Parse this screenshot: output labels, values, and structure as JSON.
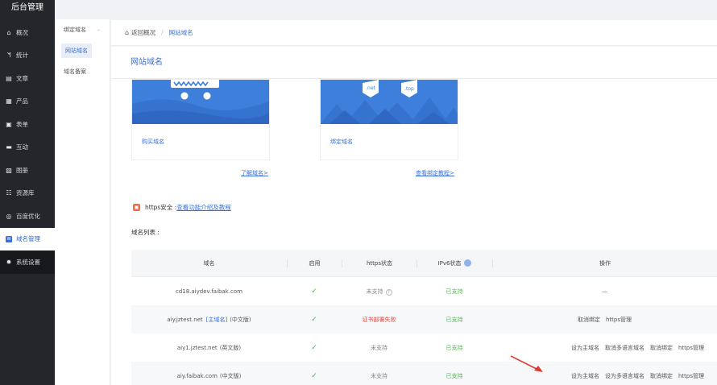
{
  "app": {
    "title": "后台管理"
  },
  "nav": {
    "items": [
      {
        "label": "概况",
        "icon": "home-icon",
        "glyph": "⌂"
      },
      {
        "label": "统计",
        "icon": "stats-icon",
        "glyph": "ᖿ"
      },
      {
        "label": "文章",
        "icon": "article-icon",
        "glyph": "▤"
      },
      {
        "label": "产品",
        "icon": "product-icon",
        "glyph": "▦"
      },
      {
        "label": "表单",
        "icon": "form-icon",
        "glyph": "▣"
      },
      {
        "label": "互动",
        "icon": "chat-icon",
        "glyph": "▬"
      },
      {
        "label": "图册",
        "icon": "gallery-icon",
        "glyph": "▧"
      },
      {
        "label": "资源库",
        "icon": "resource-icon",
        "glyph": "☷"
      },
      {
        "label": "百度优化",
        "icon": "seo-icon",
        "glyph": "◎"
      },
      {
        "label": "域名管理",
        "icon": "domain-icon",
        "glyph": "W"
      },
      {
        "label": "系统设置",
        "icon": "gear-icon",
        "glyph": "✹"
      }
    ],
    "active_index": 9
  },
  "subnav": {
    "items": [
      "绑定域名",
      "网站域名",
      "域名备案"
    ],
    "active": "网站域名"
  },
  "breadcrumb": {
    "back": "返回概况",
    "current": "网站域名"
  },
  "page": {
    "title": "网站域名"
  },
  "cards": {
    "buy": {
      "label": "购买域名"
    },
    "bind": {
      "label": "绑定域名",
      "tags": [
        ".net",
        ".top"
      ]
    }
  },
  "links": {
    "learn": "了解域名>",
    "tutorial": "查看绑定教程>"
  },
  "https": {
    "label": "https安全 :",
    "link": "查看功能介绍及教程"
  },
  "list": {
    "title": "域名列表 :"
  },
  "table": {
    "headers": [
      "域名",
      "启用",
      "https状态",
      "IPv6状态",
      "操作"
    ],
    "rows": [
      {
        "domain": "cd18.aiydev.faibak.com",
        "tag": "",
        "lang": "",
        "enabled": "✓",
        "https": "未支持",
        "https_help": "?",
        "https_color": "#888888",
        "ipv6": "已支持",
        "ops": [
          "—"
        ]
      },
      {
        "domain": "aiy.jztest.net",
        "tag": "[主域名]",
        "lang": "(中文版)",
        "enabled": "✓",
        "https": "证书部署失败",
        "https_help": "",
        "https_color": "#e0473c",
        "ipv6": "已支持",
        "ops": [
          "取消绑定",
          "https管理"
        ]
      },
      {
        "domain": "aiy1.jztest.net",
        "tag": "",
        "lang": "(英文版)",
        "enabled": "✓",
        "https": "未支持",
        "https_help": "",
        "https_color": "#888888",
        "ipv6": "已支持",
        "ops": [
          "设为主域名",
          "取消多语言域名",
          "取消绑定",
          "https管理"
        ]
      },
      {
        "domain": "aiy.faibak.com",
        "tag": "",
        "lang": "(中文版)",
        "enabled": "✓",
        "https": "未支持",
        "https_help": "",
        "https_color": "#888888",
        "ipv6": "已支持",
        "ops": [
          "设为主域名",
          "设为多语言域名",
          "取消绑定",
          "https管理"
        ]
      }
    ]
  },
  "colors": {
    "accent": "#3a6fd6",
    "nav_bg": "#24262b",
    "success": "#52b552",
    "error": "#e0473c",
    "annotation_arrow": "#e03a2e"
  }
}
